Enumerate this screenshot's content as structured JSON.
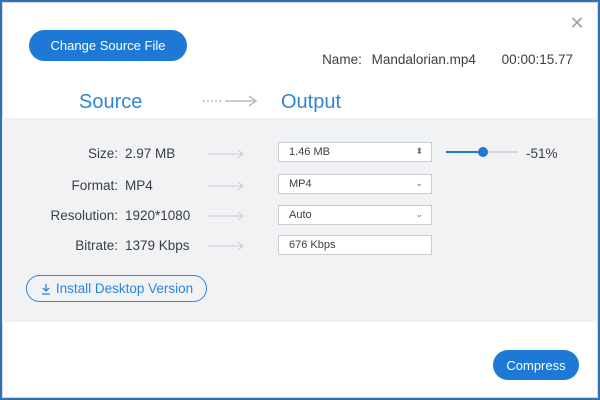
{
  "toolbar": {
    "change_source_label": "Change Source File"
  },
  "file": {
    "name_label": "Name:",
    "name": "Mandalorian.mp4",
    "duration": "00:00:15.77"
  },
  "headers": {
    "source": "Source",
    "output": "Output"
  },
  "rows": {
    "size": {
      "label": "Size:",
      "source": "2.97 MB",
      "output": "1.46  MB",
      "percent": "-51%"
    },
    "format": {
      "label": "Format:",
      "source": "MP4",
      "output": "MP4"
    },
    "resolution": {
      "label": "Resolution:",
      "source": "1920*1080",
      "output": "Auto"
    },
    "bitrate": {
      "label": "Bitrate:",
      "source": "1379 Kbps",
      "output": "676 Kbps"
    }
  },
  "slider": {
    "reduction_fraction": 0.51
  },
  "actions": {
    "install_label": "Install Desktop Version",
    "compress_label": "Compress"
  },
  "icons": {
    "close": "close-icon",
    "download": "download-icon"
  },
  "colors": {
    "accent": "#1d78d6",
    "panel": "#f1f2f4"
  }
}
